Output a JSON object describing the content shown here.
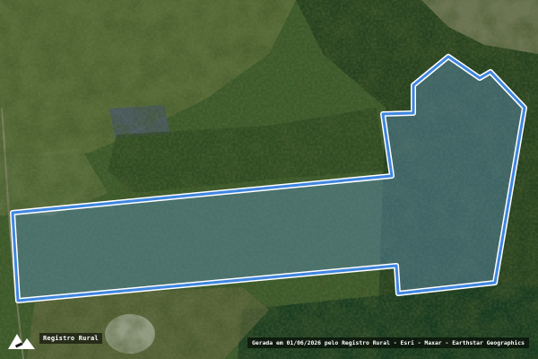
{
  "map": {
    "type": "satellite",
    "colors": {
      "parcel_fill": "#5b8fb8",
      "parcel_stroke": "#3f86e0",
      "parcel_stroke_inner": "#ffffff"
    }
  },
  "branding": {
    "logo_icon": "registro-rural-logo-icon",
    "name": "Registro Rural"
  },
  "attribution": {
    "text": "Gerada em 01/06/2026 pelo Registro Rural - Esri - Maxar - Earthstar Geographics"
  }
}
